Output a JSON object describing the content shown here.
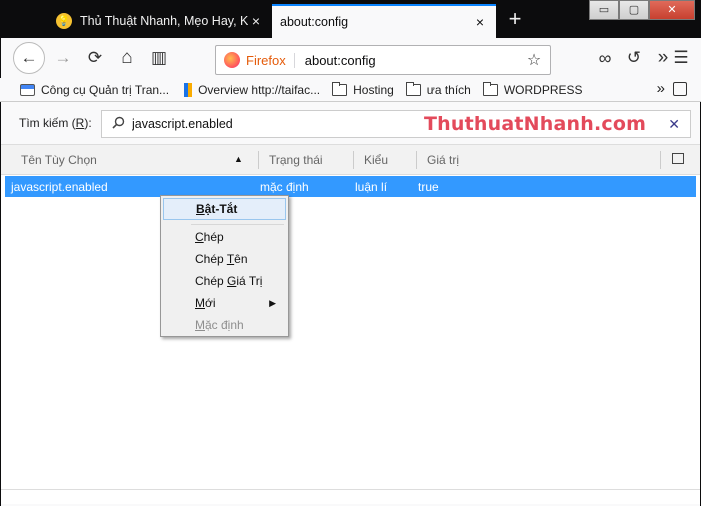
{
  "tabs": [
    {
      "title": "Thủ Thuật Nhanh, Mẹo Hay, Kiến Thức",
      "close": "×"
    },
    {
      "title": "about:config",
      "close": "×"
    }
  ],
  "newtab": "+",
  "window_buttons": {
    "minimize": "▭",
    "maximize": "▢",
    "close": "✕"
  },
  "nav": {
    "back": "←",
    "forward": "→",
    "reload": "⟳",
    "home": "⌂",
    "sidebar": "▥",
    "identity": "Firefox",
    "url": "about:config",
    "star": "☆",
    "mask": "∞",
    "history": "↺",
    "overflow": "»",
    "menu": "☰"
  },
  "bookmarks": [
    {
      "label": "Công cụ Quản trị Tran...",
      "icon": "webmaster-icon"
    },
    {
      "label": "Overview http://taifac...",
      "icon": "analytics-icon"
    },
    {
      "label": "Hosting",
      "icon": "folder-icon"
    },
    {
      "label": "ưa thích",
      "icon": "folder-icon"
    },
    {
      "label": "WORDPRESS",
      "icon": "folder-icon"
    }
  ],
  "bookmarks_more": "»",
  "search": {
    "label_pre": "Tìm kiếm (",
    "label_key": "R",
    "label_post": "):",
    "value": "javascript.enabled",
    "clear": "✕"
  },
  "watermark": "ThuthuatNhanh.com",
  "columns": [
    "Tên Tùy Chọn",
    "Trạng thái",
    "Kiểu",
    "Giá trị"
  ],
  "sort_indicator": "▲",
  "rows": [
    {
      "name": "javascript.enabled",
      "status": "mặc định",
      "type": "luận lí",
      "value": "true"
    }
  ],
  "context_menu": [
    {
      "pre": "",
      "key": "B",
      "post": "ật-Tắt",
      "bold": true
    },
    {
      "pre": "",
      "key": "C",
      "post": "hép"
    },
    {
      "pre": "Chép ",
      "key": "T",
      "post": "ên"
    },
    {
      "pre": "Chép ",
      "key": "G",
      "post": "iá Trị"
    },
    {
      "pre": "",
      "key": "M",
      "post": "ới",
      "submenu": "▶"
    },
    {
      "pre": "",
      "key": "M",
      "post": "ặc định",
      "disabled": true
    }
  ]
}
